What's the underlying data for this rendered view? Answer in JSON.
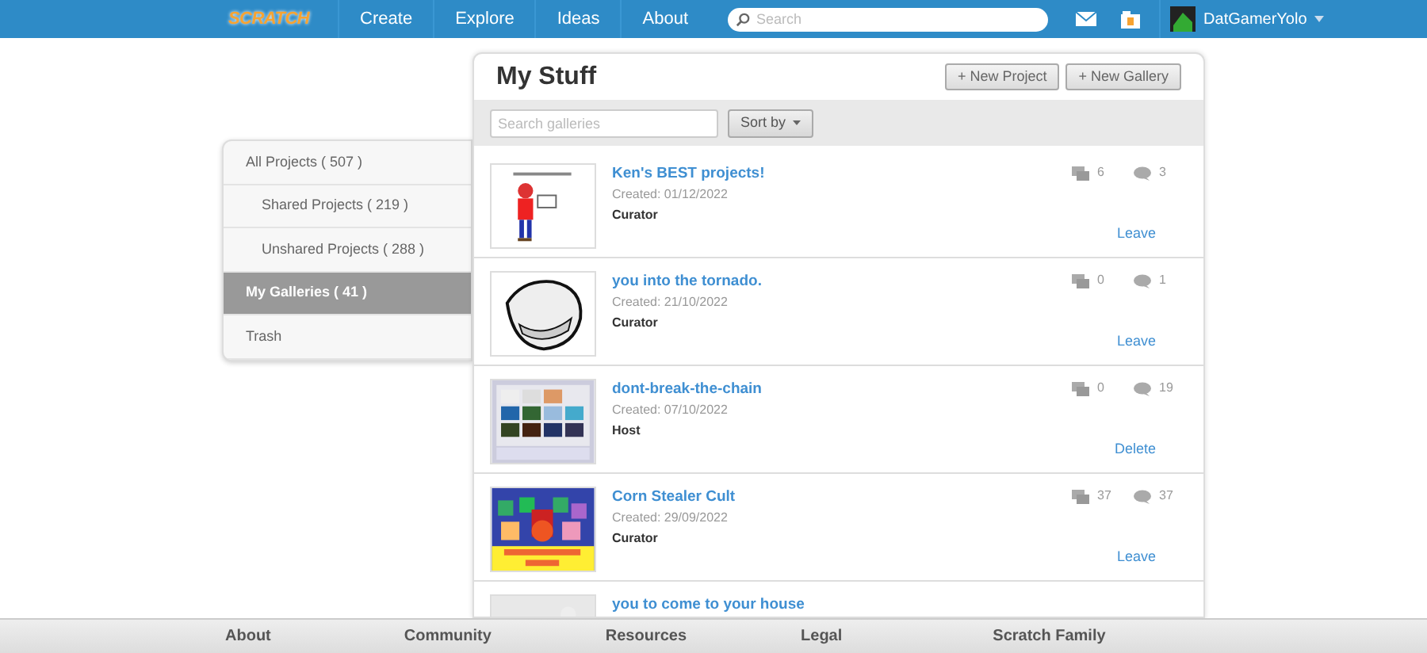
{
  "nav": {
    "logo": "SCRATCH",
    "links": [
      "Create",
      "Explore",
      "Ideas",
      "About"
    ],
    "search": {
      "placeholder": "Search"
    },
    "user": "DatGamerYolo"
  },
  "sidebar": {
    "items": [
      {
        "label": "All Projects ( 507 )",
        "selected": false,
        "indent": false
      },
      {
        "label": "Shared Projects ( 219 )",
        "selected": false,
        "indent": true
      },
      {
        "label": "Unshared Projects ( 288 )",
        "selected": false,
        "indent": true
      },
      {
        "label": "My Galleries ( 41 )",
        "selected": true,
        "indent": false
      },
      {
        "label": "Trash",
        "selected": false,
        "indent": false
      }
    ]
  },
  "panel": {
    "title": "My Stuff",
    "buttons": [
      "+ New Project",
      "+ New Gallery"
    ],
    "search": {
      "placeholder": "Search galleries"
    },
    "sort": "Sort by",
    "galleries": [
      {
        "title": "Ken's **BEST** projects!",
        "created": "Created: 01/12/2022",
        "role": "Curator",
        "projects": "6",
        "comments": "3",
        "action": "Leave"
      },
      {
        "title": "you into the tornado.",
        "created": "Created: 21/10/2022",
        "role": "Curator",
        "projects": "0",
        "comments": "1",
        "action": "Leave"
      },
      {
        "title": "dont-break-the-chain",
        "created": "Created: 07/10/2022",
        "role": "Host",
        "projects": "0",
        "comments": "19",
        "action": "Delete"
      },
      {
        "title": "Corn Stealer Cult",
        "created": "Created: 29/09/2022",
        "role": "Curator",
        "projects": "37",
        "comments": "37",
        "action": "Leave"
      },
      {
        "title": "you to come to your house"
      }
    ]
  },
  "footer": [
    "About",
    "Community",
    "Resources",
    "Legal",
    "Scratch Family"
  ]
}
